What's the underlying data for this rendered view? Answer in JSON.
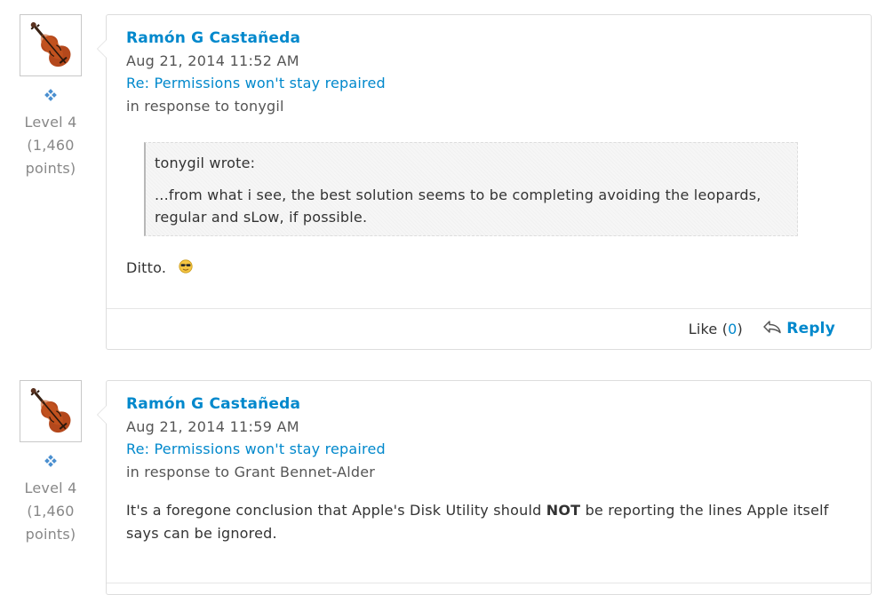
{
  "posts": [
    {
      "author": "Ramón G Castañeda",
      "date": "Aug 21, 2014 11:52 AM",
      "subject": "Re: Permissions won't stay repaired",
      "in_response_to": "in response to tonygil",
      "level_lines": [
        "Level 4",
        "(1,460",
        "points)"
      ],
      "quote": {
        "author": "tonygil wrote:",
        "lines": [
          "...from what i see, the best solution seems to be completing avoiding the leopards,",
          "regular and sLow, if possible."
        ]
      },
      "body": "Ditto.",
      "footer": {
        "like_label": "Like (",
        "like_count": "0",
        "like_close": ")",
        "reply_label": "Reply"
      }
    },
    {
      "author": "Ramón G Castañeda",
      "date": "Aug 21, 2014 11:59 AM",
      "subject": "Re: Permissions won't stay repaired",
      "in_response_to": "in response to Grant Bennet-Alder",
      "level_lines": [
        "Level 4",
        "(1,460",
        "points)"
      ],
      "body_before": "It's a foregone conclusion that Apple's Disk Utility should ",
      "body_bold": "NOT",
      "body_after": " be reporting the lines Apple itself says can be ignored."
    }
  ],
  "icons": {
    "avatar": "violin-avatar-icon",
    "level": "level-diamond-icon",
    "emoji": "cool-sunglasses-emoji-icon",
    "reply": "reply-arrow-icon"
  },
  "colors": {
    "link": "#0088cc",
    "text": "#333333",
    "muted": "#888888",
    "border": "#dddddd"
  }
}
